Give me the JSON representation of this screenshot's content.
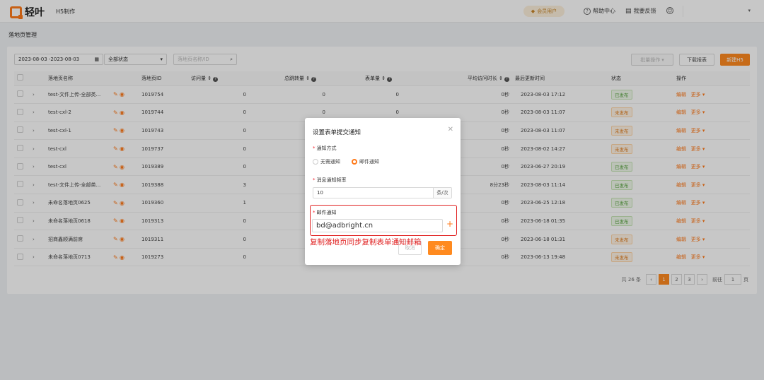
{
  "header": {
    "logo_text": "轻叶",
    "app_name": "H5制作",
    "vip_label": "会员用户",
    "help_label": "帮助中心",
    "feedback_label": "我要反馈",
    "colors": {
      "accent": "#ff7a1a"
    }
  },
  "breadcrumb": "落地页管理",
  "filters": {
    "date_range": "2023-08-03  -2023-08-03",
    "status_select": "全部状态",
    "search_placeholder": "落地页名称/ID"
  },
  "buttons": {
    "batch": "批量操作",
    "download": "下载报表",
    "new_h5": "新建H5"
  },
  "table": {
    "headers": [
      "落地页名称",
      "落地页ID",
      "访问量",
      "总跳转量",
      "表单量",
      "平均访问时长",
      "最后更新时间",
      "状态",
      "操作"
    ],
    "rows": [
      {
        "name": "test-文件上传-全部类...",
        "id": "1019754",
        "visits": "0",
        "jumps": "0",
        "forms": "0",
        "avg": "0秒",
        "updated": "2023-08-03 17:12",
        "status": "已发布",
        "published": true
      },
      {
        "name": "test-cxl-2",
        "id": "1019744",
        "visits": "0",
        "jumps": "0",
        "forms": "0",
        "avg": "0秒",
        "updated": "2023-08-03 11:07",
        "status": "未发布",
        "published": false
      },
      {
        "name": "test-cxl-1",
        "id": "1019743",
        "visits": "0",
        "jumps": "",
        "forms": "",
        "avg": "0秒",
        "updated": "2023-08-03 11:07",
        "status": "未发布",
        "published": false
      },
      {
        "name": "test-cxl",
        "id": "1019737",
        "visits": "0",
        "jumps": "",
        "forms": "",
        "avg": "0秒",
        "updated": "2023-08-02 14:27",
        "status": "未发布",
        "published": false
      },
      {
        "name": "test-cxl",
        "id": "1019389",
        "visits": "0",
        "jumps": "",
        "forms": "",
        "avg": "0秒",
        "updated": "2023-06-27 20:19",
        "status": "已发布",
        "published": true
      },
      {
        "name": "test-文件上传-全部类...",
        "id": "1019388",
        "visits": "3",
        "jumps": "",
        "forms": "",
        "avg": "8分23秒",
        "updated": "2023-08-03 11:14",
        "status": "已发布",
        "published": true
      },
      {
        "name": "未命名落地页0625",
        "id": "1019360",
        "visits": "1",
        "jumps": "",
        "forms": "",
        "avg": "0秒",
        "updated": "2023-06-25 12:18",
        "status": "已发布",
        "published": true
      },
      {
        "name": "未命名落地页0618",
        "id": "1019313",
        "visits": "0",
        "jumps": "",
        "forms": "",
        "avg": "0秒",
        "updated": "2023-06-18 01:35",
        "status": "已发布",
        "published": true
      },
      {
        "name": "招商鑫顺满前席",
        "id": "1019311",
        "visits": "0",
        "jumps": "",
        "forms": "",
        "avg": "0秒",
        "updated": "2023-06-18 01:31",
        "status": "未发布",
        "published": false
      },
      {
        "name": "未命名落地页0713",
        "id": "1019273",
        "visits": "0",
        "jumps": "",
        "forms": "",
        "avg": "0秒",
        "updated": "2023-06-13 19:48",
        "status": "未发布",
        "published": false
      }
    ],
    "edit_label": "编辑",
    "more_label": "更多"
  },
  "pagination": {
    "total": "共 26 条",
    "pages": [
      "1",
      "2",
      "3"
    ],
    "goto_label": "前往",
    "goto_value": "1",
    "page_unit": "页"
  },
  "modal": {
    "title": "设置表单提交通知",
    "method_label": "通知方式",
    "option_none": "无需通知",
    "option_email": "邮件通知",
    "freq_label": "消息通知频率",
    "freq_value": "10",
    "freq_unit": "条/次",
    "email_label": "邮件通知",
    "email_value": "bd@adbright.cn",
    "cancel": "取消",
    "confirm": "确定"
  },
  "annotation": "复制落地页同步复制表单通知邮箱"
}
